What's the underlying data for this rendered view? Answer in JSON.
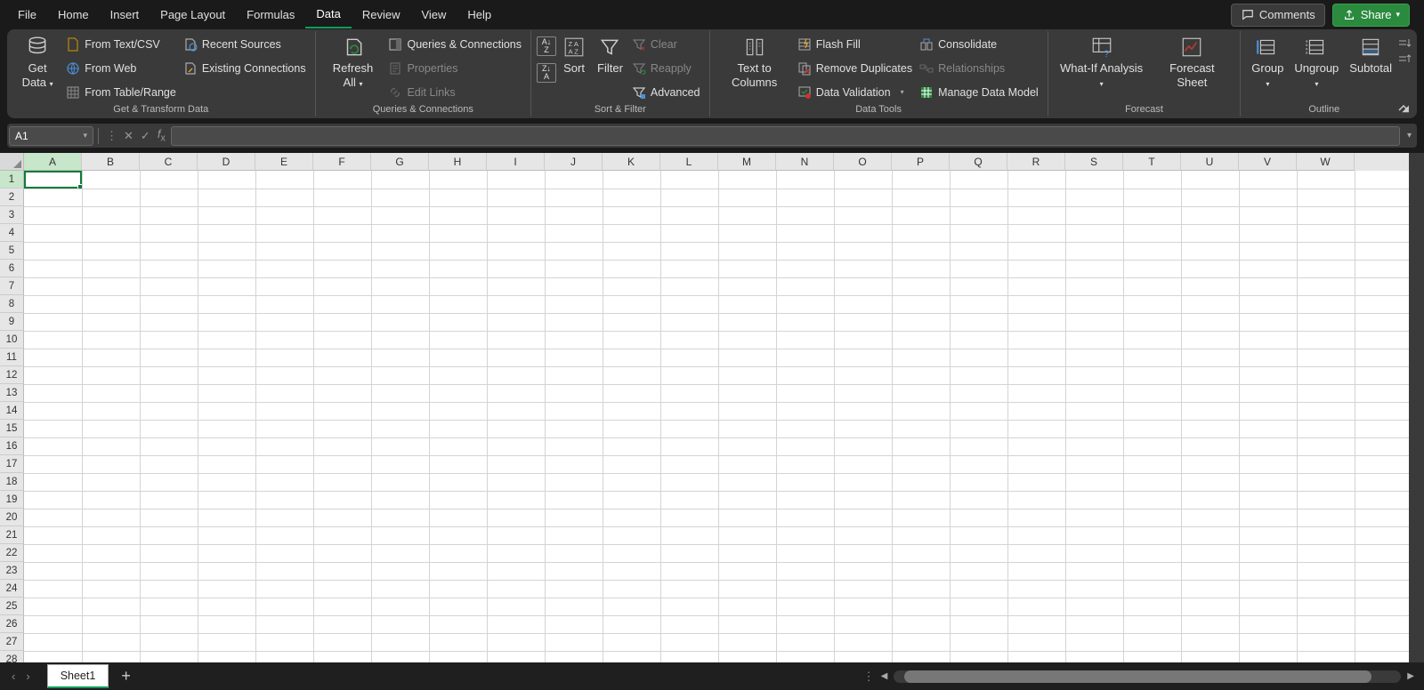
{
  "tabs": [
    "File",
    "Home",
    "Insert",
    "Page Layout",
    "Formulas",
    "Data",
    "Review",
    "View",
    "Help"
  ],
  "activeTab": "Data",
  "header": {
    "comments": "Comments",
    "share": "Share"
  },
  "ribbon": {
    "getTransform": {
      "label": "Get & Transform Data",
      "getData": "Get Data",
      "fromTextCsv": "From Text/CSV",
      "recentSources": "Recent Sources",
      "fromWeb": "From Web",
      "existingConnections": "Existing Connections",
      "fromTableRange": "From Table/Range"
    },
    "queries": {
      "label": "Queries & Connections",
      "refreshAll": "Refresh All",
      "queriesConnections": "Queries & Connections",
      "properties": "Properties",
      "editLinks": "Edit Links"
    },
    "sortFilter": {
      "label": "Sort & Filter",
      "sort": "Sort",
      "filter": "Filter",
      "clear": "Clear",
      "reapply": "Reapply",
      "advanced": "Advanced"
    },
    "dataTools": {
      "label": "Data Tools",
      "textToColumns": "Text to Columns",
      "flashFill": "Flash Fill",
      "removeDuplicates": "Remove Duplicates",
      "dataValidation": "Data Validation",
      "consolidate": "Consolidate",
      "relationships": "Relationships",
      "manageDataModel": "Manage Data Model"
    },
    "forecast": {
      "label": "Forecast",
      "whatIf": "What-If Analysis",
      "forecastSheet": "Forecast Sheet"
    },
    "outline": {
      "label": "Outline",
      "group": "Group",
      "ungroup": "Ungroup",
      "subtotal": "Subtotal"
    }
  },
  "nameBox": "A1",
  "formulaValue": "",
  "columns": [
    "A",
    "B",
    "C",
    "D",
    "E",
    "F",
    "G",
    "H",
    "I",
    "J",
    "K",
    "L",
    "M",
    "N",
    "O",
    "P",
    "Q",
    "R",
    "S",
    "T",
    "U",
    "V",
    "W"
  ],
  "rows": 28,
  "sheet": "Sheet1"
}
